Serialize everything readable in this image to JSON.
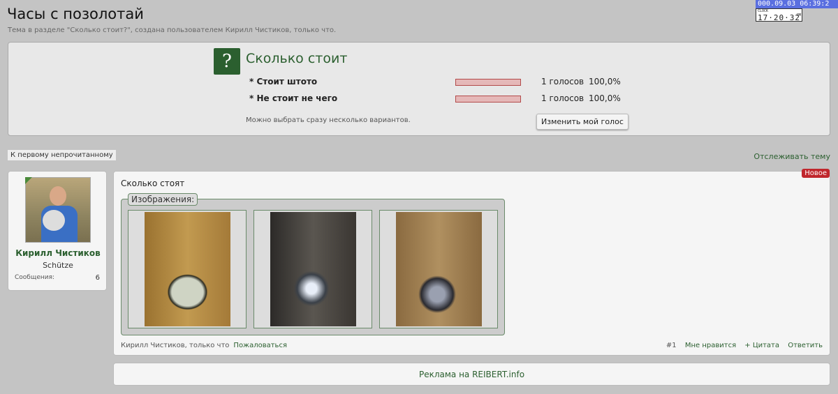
{
  "header": {
    "title": "Часы с позолотай",
    "subtitle": "Тема в разделе \"Сколько стоит?\", создана пользователем Кирилл Чистиков, только что."
  },
  "clock": {
    "date": "000.09.03 06:39:2",
    "label": "CLOCK",
    "time": "17·20·32",
    "ampm": "PM"
  },
  "poll": {
    "icon": "question-icon",
    "icon_glyph": "?",
    "title": "Сколько стоит",
    "options": [
      {
        "label": "* Стоит штото",
        "votes": "1 голосов",
        "percent": "100,0%",
        "fraction": 1.0
      },
      {
        "label": "* Не стоит не чего",
        "votes": "1 голосов",
        "percent": "100,0%",
        "fraction": 1.0
      }
    ],
    "note": "Можно выбрать сразу несколько вариантов.",
    "change_vote": "Изменить мой голос",
    "bar_color": "#e5b8b8"
  },
  "nav": {
    "first_unread": "К первому непрочитанному",
    "follow": "Отслеживать тему"
  },
  "user": {
    "name": "Кирилл Чистиков",
    "rank": "Schütze",
    "messages_label": "Сообщения:",
    "messages": "6"
  },
  "post": {
    "badge": "Новое",
    "text": "Сколько стоят",
    "gallery_label": "Изображения:",
    "author_time": "Кирилл Чистиков, только что",
    "report": "Пожаловаться",
    "number": "#1",
    "like": "Мне нравится",
    "quote": "+ Цитата",
    "reply": "Ответить"
  },
  "ad": {
    "text": "Реклама на REIBERT.info"
  },
  "colors": {
    "accent": "#2b5f2f",
    "badge": "#c0272d"
  }
}
